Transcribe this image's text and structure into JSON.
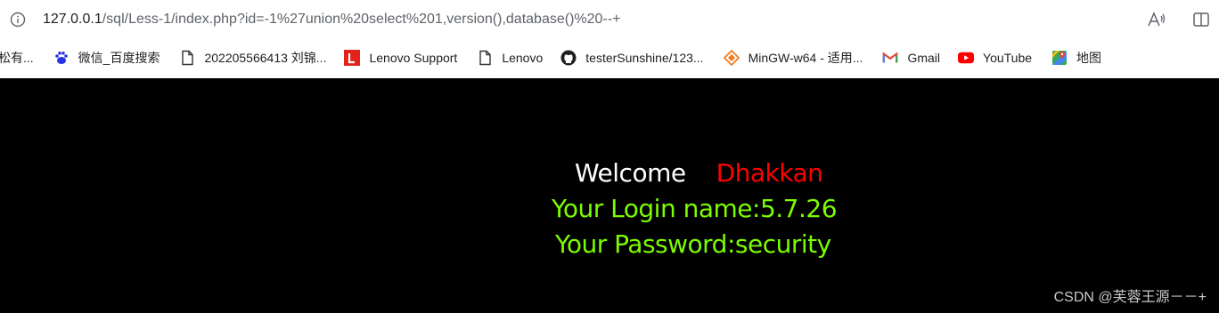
{
  "browser": {
    "url_host": "127.0.0.1",
    "url_path": "/sql/Less-1/index.php?id=-1%27union%20select%201,version(),database()%20--+",
    "icons": [
      "info-icon",
      "read-aloud-icon",
      "split-screen-icon"
    ]
  },
  "bookmarks": [
    {
      "label": "松有...",
      "icon": "none"
    },
    {
      "label": "微信_百度搜索",
      "icon": "baidu-icon"
    },
    {
      "label": "202205566413 刘锦...",
      "icon": "file-icon"
    },
    {
      "label": "Lenovo Support",
      "icon": "lenovo-icon"
    },
    {
      "label": "Lenovo",
      "icon": "file-icon"
    },
    {
      "label": "testerSunshine/123...",
      "icon": "github-icon"
    },
    {
      "label": "MinGW-w64 - 适用...",
      "icon": "sourceforge-icon"
    },
    {
      "label": "Gmail",
      "icon": "gmail-icon"
    },
    {
      "label": "YouTube",
      "icon": "youtube-icon"
    },
    {
      "label": "地图",
      "icon": "maps-icon"
    }
  ],
  "page": {
    "welcome": "Welcome",
    "name": "Dhakkan",
    "login_line": "Your Login name:5.7.26",
    "password_line": "Your Password:security"
  },
  "watermark": "CSDN @芙蓉王源－－+",
  "colors": {
    "background": "#000000",
    "welcome": "#ffffff",
    "name": "#ff0000",
    "result": "#7cfc00"
  }
}
